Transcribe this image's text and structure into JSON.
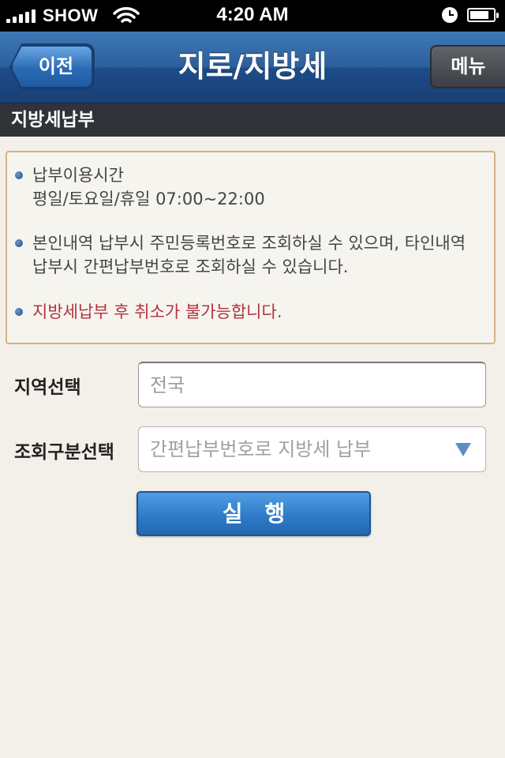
{
  "status_bar": {
    "carrier": "SHOW",
    "time": "4:20 AM",
    "battery_level": 0.85
  },
  "nav": {
    "back_label": "이전",
    "title": "지로/지방세",
    "menu_label": "메뉴"
  },
  "section": {
    "title": "지방세납부"
  },
  "notices": [
    {
      "text_line1": "납부이용시간",
      "text_line2": "평일/토요일/휴일 07:00~22:00"
    },
    {
      "text_line1": "본인내역 납부시 주민등록번호로 조회하실 수 있으며, 타인내역",
      "text_line2": "납부시 간편납부번호로 조회하실 수 있습니다."
    },
    {
      "text_line1": "지방세납부 후 취소가 불가능합니다.",
      "color": "#b2333c"
    }
  ],
  "form": {
    "region_label": "지역선택",
    "region_placeholder": "전국",
    "lookup_label": "조회구분선택",
    "lookup_selected": "간편납부번호로 지방세 납부"
  },
  "actions": {
    "execute_label": "실행"
  },
  "colors": {
    "nav_blue": "#2c5f9c",
    "section_dark": "#303338",
    "background": "#f3efe9",
    "warning_red": "#b2333c",
    "button_blue": "#2e79c6"
  }
}
